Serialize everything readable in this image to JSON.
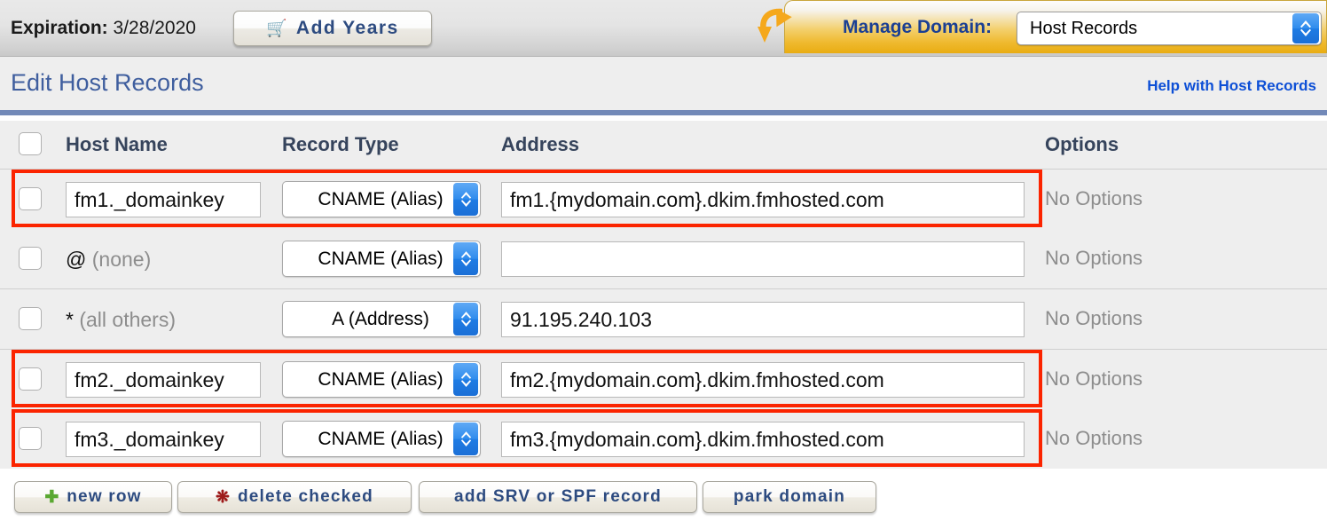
{
  "topbar": {
    "expiration_label": "Expiration:",
    "expiration_value": "3/28/2020",
    "add_years_label": "Add Years",
    "cart_icon": "shopping-cart-icon",
    "arrow_icon": "curved-arrow-icon",
    "manage_domain_label": "Manage Domain:",
    "manage_domain_value": "Host Records"
  },
  "section": {
    "title": "Edit Host Records",
    "help_link": "Help with Host Records"
  },
  "table": {
    "columns": [
      "Host Name",
      "Record Type",
      "Address",
      "Options"
    ],
    "rows": [
      {
        "host": "fm1._domainkey",
        "host_editable": true,
        "host_note": "",
        "type": "CNAME (Alias)",
        "address": "fm1.{mydomain.com}.dkim.fmhosted.com",
        "options": "No Options",
        "highlighted": true,
        "checked": false
      },
      {
        "host": "@",
        "host_editable": false,
        "host_note": "(none)",
        "type": "CNAME (Alias)",
        "address": "",
        "options": "No Options",
        "highlighted": false,
        "checked": false
      },
      {
        "host": "*",
        "host_editable": false,
        "host_note": "(all others)",
        "type": "A (Address)",
        "address": "91.195.240.103",
        "options": "No Options",
        "highlighted": false,
        "checked": false
      },
      {
        "host": "fm2._domainkey",
        "host_editable": true,
        "host_note": "",
        "type": "CNAME (Alias)",
        "address": "fm2.{mydomain.com}.dkim.fmhosted.com",
        "options": "No Options",
        "highlighted": true,
        "checked": false
      },
      {
        "host": "fm3._domainkey",
        "host_editable": true,
        "host_note": "",
        "type": "CNAME (Alias)",
        "address": "fm3.{mydomain.com}.dkim.fmhosted.com",
        "options": "No Options",
        "highlighted": true,
        "checked": false
      }
    ]
  },
  "footer": {
    "new_row": "new row",
    "delete_checked": "delete checked",
    "add_srv_or_spf": "add SRV or SPF record",
    "park_domain": "park domain",
    "plus_icon": "plus-icon",
    "delete_icon": "asterisk-delete-icon"
  },
  "colors": {
    "highlight_red": "#fb2400",
    "link_blue": "#0d4fd6",
    "title_blue": "#3f5e9e",
    "header_yellow": "#efb92e",
    "button_text_blue": "#2d4b80",
    "muted_gray": "#8d8d8d",
    "divider_blue": "#7289b8"
  }
}
